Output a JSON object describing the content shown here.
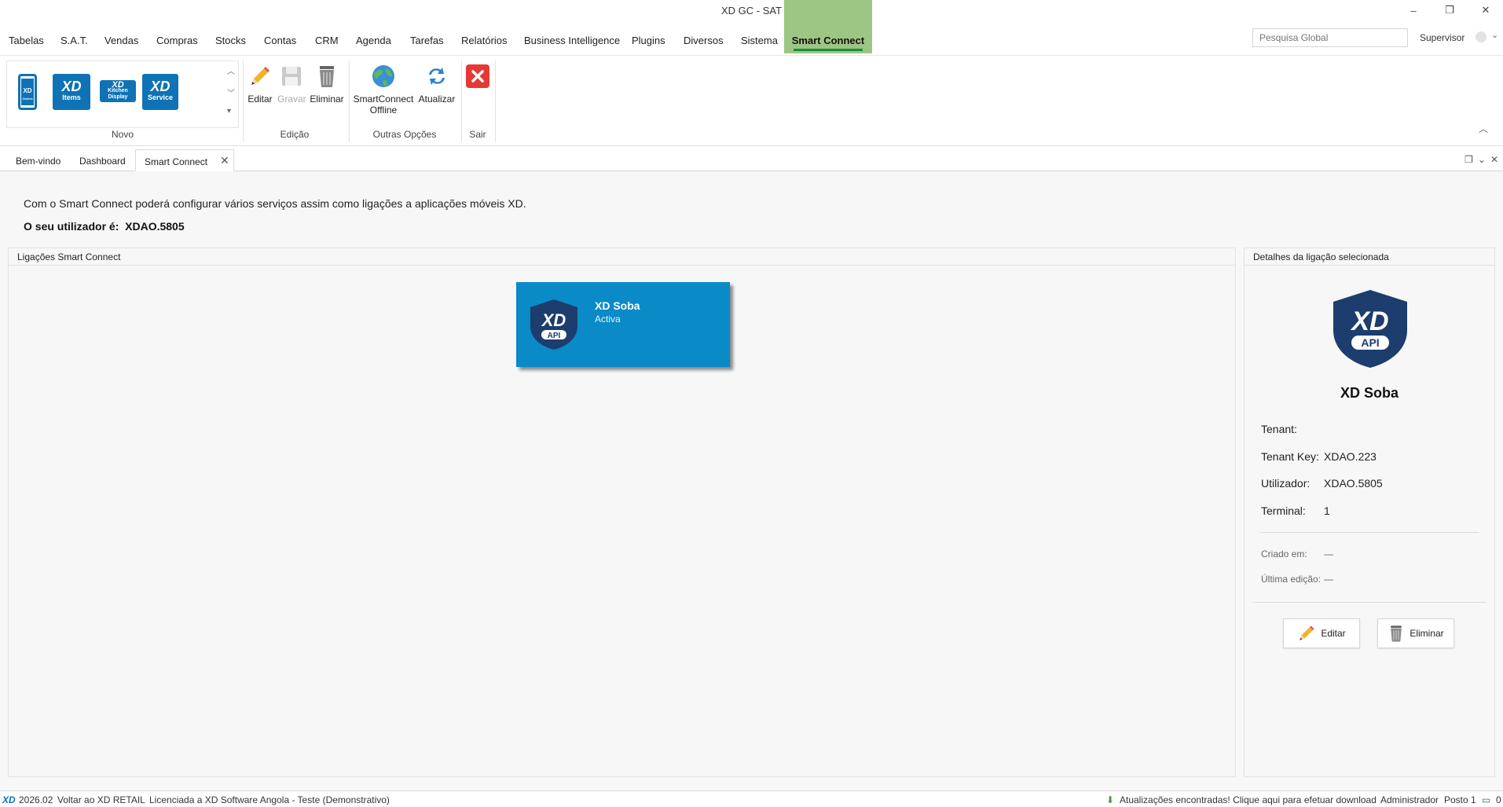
{
  "window": {
    "title": "XD GC - SAT",
    "minimize": "–",
    "maximize": "❐",
    "close": "✕"
  },
  "menu": {
    "items": [
      "Tabelas",
      "S.A.T.",
      "Vendas",
      "Compras",
      "Stocks",
      "Contas",
      "CRM",
      "Agenda",
      "Tarefas",
      "Relatórios",
      "Business Intelligence",
      "Plugins",
      "Diversos",
      "Sistema"
    ],
    "active": "Smart Connect",
    "search_placeholder": "Pesquisa Global",
    "user": "Supervisor"
  },
  "ribbon": {
    "gallery_tiles": [
      "XD Orders",
      "XD Items",
      "XD Kitchen Display",
      "XD Service"
    ],
    "groups": {
      "novo": "Novo",
      "edicao": "Edição",
      "outras": "Outras Opções",
      "sair": "Sair"
    },
    "buttons": {
      "editar": "Editar",
      "gravar": "Gravar",
      "eliminar": "Eliminar",
      "smartconnect_offline_1": "SmartConnect",
      "smartconnect_offline_2": "Offline",
      "atualizar": "Atualizar"
    },
    "tile_text": {
      "items": "Items",
      "service": "Service",
      "kitchen": "Kitchen Display",
      "orders": "Orders"
    }
  },
  "tabs": [
    "Bem-vindo",
    "Dashboard",
    "Smart Connect"
  ],
  "content": {
    "intro": "Com o Smart Connect poderá configurar vários serviços assim como ligações a aplicações móveis XD.",
    "user_label": "O seu utilizador é:",
    "user_value": "XDAO.5805",
    "connections_title": "Ligações Smart Connect",
    "details_title": "Detalhes da ligação selecionada"
  },
  "connection_card": {
    "name": "XD Soba",
    "status": "Activa",
    "logo_text": "XD",
    "logo_sub": "API"
  },
  "details": {
    "name": "XD Soba",
    "tenant_label": "Tenant:",
    "tenant_value": "",
    "tenant_key_label": "Tenant Key:",
    "tenant_key_value": "XDAO.223",
    "utilizador_label": "Utilizador:",
    "utilizador_value": "XDAO.5805",
    "terminal_label": "Terminal:",
    "terminal_value": "1",
    "criado_label": "Criado em:",
    "criado_value": "—",
    "ultima_label": "Última edição:",
    "ultima_value": "—",
    "editar": "Editar",
    "eliminar": "Eliminar"
  },
  "statusbar": {
    "version": "2026.02",
    "back": "Voltar ao XD RETAIL",
    "license": "Licenciada a XD Software Angola - Teste (Demonstrativo)",
    "updates": "Atualizações encontradas! Clique aqui para efetuar download",
    "role": "Administrador",
    "posto": "Posto 1",
    "messages": "0"
  },
  "colors": {
    "accent_green": "#9dc684",
    "card_blue": "#0a8ac7",
    "logo_navy": "#1c3d6e"
  }
}
